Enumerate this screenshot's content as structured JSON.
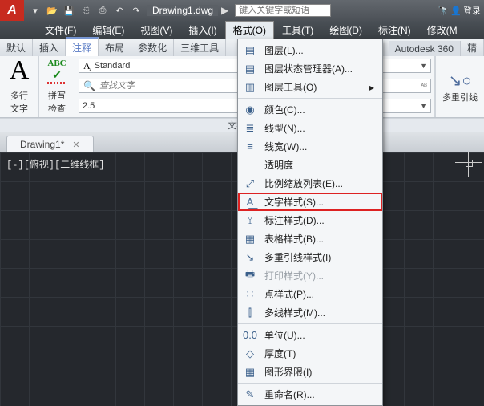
{
  "title": {
    "doc": "Drawing1.dwg",
    "search_ph": "键入关键字或短语",
    "login": "登录"
  },
  "menu": {
    "items": [
      "文件(F)",
      "编辑(E)",
      "视图(V)",
      "插入(I)",
      "格式(O)",
      "工具(T)",
      "绘图(D)",
      "标注(N)",
      "修改(M"
    ]
  },
  "tabs": {
    "items": [
      "默认",
      "插入",
      "注释",
      "布局",
      "参数化",
      "三维工具"
    ],
    "right": "Autodesk 360",
    "far": "精"
  },
  "ribbon": {
    "mtext": "多行\n文字",
    "spell": "拼写\n检查",
    "abc": "ABC",
    "style": "Standard",
    "find_ph": "查找文字",
    "height": "2.5",
    "panel": "文字 ▼",
    "leader": "多重引线"
  },
  "doctab": {
    "name": "Drawing1*"
  },
  "canvas": {
    "view": "[-][俯视][二维线框]"
  },
  "dd": [
    {
      "ic": "▤",
      "t": "图层(L)..."
    },
    {
      "ic": "▤",
      "t": "图层状态管理器(A)..."
    },
    {
      "ic": "▥",
      "t": "图层工具(O)",
      "arrow": "▸"
    },
    {
      "ic": "◉",
      "t": "颜色(C)...",
      "sep": true
    },
    {
      "ic": "≣",
      "t": "线型(N)..."
    },
    {
      "ic": "≡",
      "t": "线宽(W)..."
    },
    {
      "ic": "",
      "t": "透明度"
    },
    {
      "ic": "⤢",
      "t": "比例缩放列表(E)...",
      "sepAfter": true
    },
    {
      "ic": "A͟",
      "t": "文字样式(S)...",
      "hl": true
    },
    {
      "ic": "⟟",
      "t": "标注样式(D)..."
    },
    {
      "ic": "▦",
      "t": "表格样式(B)..."
    },
    {
      "ic": "↘",
      "t": "多重引线样式(I)"
    },
    {
      "ic": "🖶",
      "t": "打印样式(Y)...",
      "dis": true
    },
    {
      "ic": "∷",
      "t": "点样式(P)..."
    },
    {
      "ic": "⫿",
      "t": "多线样式(M)..."
    },
    {
      "ic": "0.0",
      "t": "单位(U)...",
      "sep": true
    },
    {
      "ic": "◇",
      "t": "厚度(T)"
    },
    {
      "ic": "▦",
      "t": "图形界限(I)"
    },
    {
      "ic": "✎",
      "t": "重命名(R)...",
      "sep": true
    }
  ]
}
